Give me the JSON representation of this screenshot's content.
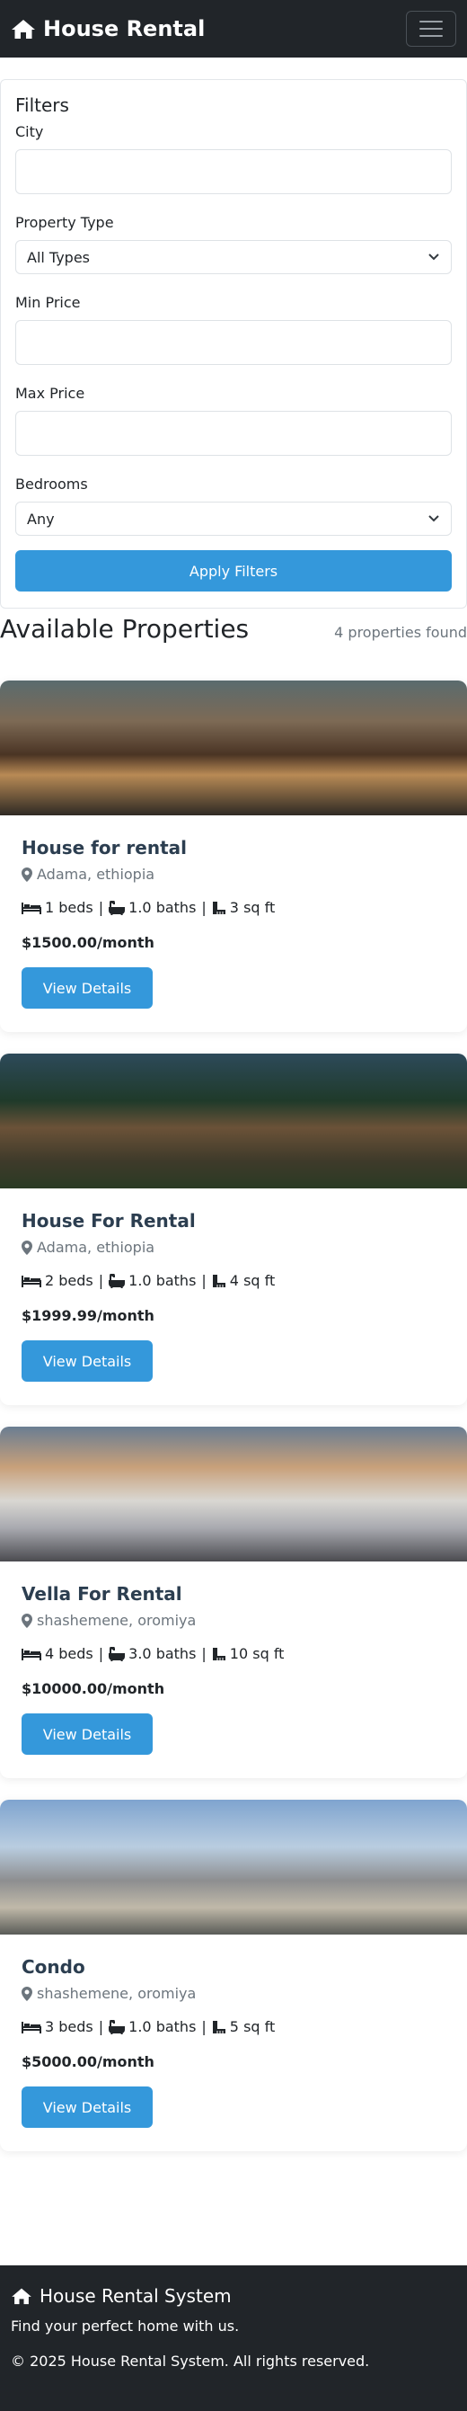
{
  "navbar": {
    "brand": "House Rental",
    "brand_icon": "home-icon",
    "menu_icon": "hamburger-icon"
  },
  "filters": {
    "title": "Filters",
    "city_label": "City",
    "city_value": "",
    "type_label": "Property Type",
    "type_value": "All Types",
    "min_label": "Min Price",
    "min_value": "",
    "max_label": "Max Price",
    "max_value": "",
    "bed_label": "Bedrooms",
    "bed_value": "Any",
    "apply_label": "Apply Filters"
  },
  "listing": {
    "title": "Available Properties",
    "count": "4 properties found"
  },
  "properties": [
    {
      "title": "House for rental",
      "location": "Adama, ethiopia",
      "beds": "1 beds",
      "baths": "1.0 baths",
      "sqft": "3 sq ft",
      "price": "$1500.00/month",
      "button": "View Details"
    },
    {
      "title": "House For Rental",
      "location": "Adama, ethiopia",
      "beds": "2 beds",
      "baths": "1.0 baths",
      "sqft": "4 sq ft",
      "price": "$1999.99/month",
      "button": "View Details"
    },
    {
      "title": "Vella For Rental",
      "location": "shashemene, oromiya",
      "beds": "4 beds",
      "baths": "3.0 baths",
      "sqft": "10 sq ft",
      "price": "$10000.00/month",
      "button": "View Details"
    },
    {
      "title": "Condo",
      "location": "shashemene, oromiya",
      "beds": "3 beds",
      "baths": "1.0 baths",
      "sqft": "5 sq ft",
      "price": "$5000.00/month",
      "button": "View Details"
    }
  ],
  "footer": {
    "brand": "House Rental System",
    "tagline": "Find your perfect home with us.",
    "copyright": "© 2025 House Rental System. All rights reserved."
  },
  "colors": {
    "navbar": "#212529",
    "accent": "#3498db",
    "card_title": "#2c3e50"
  }
}
